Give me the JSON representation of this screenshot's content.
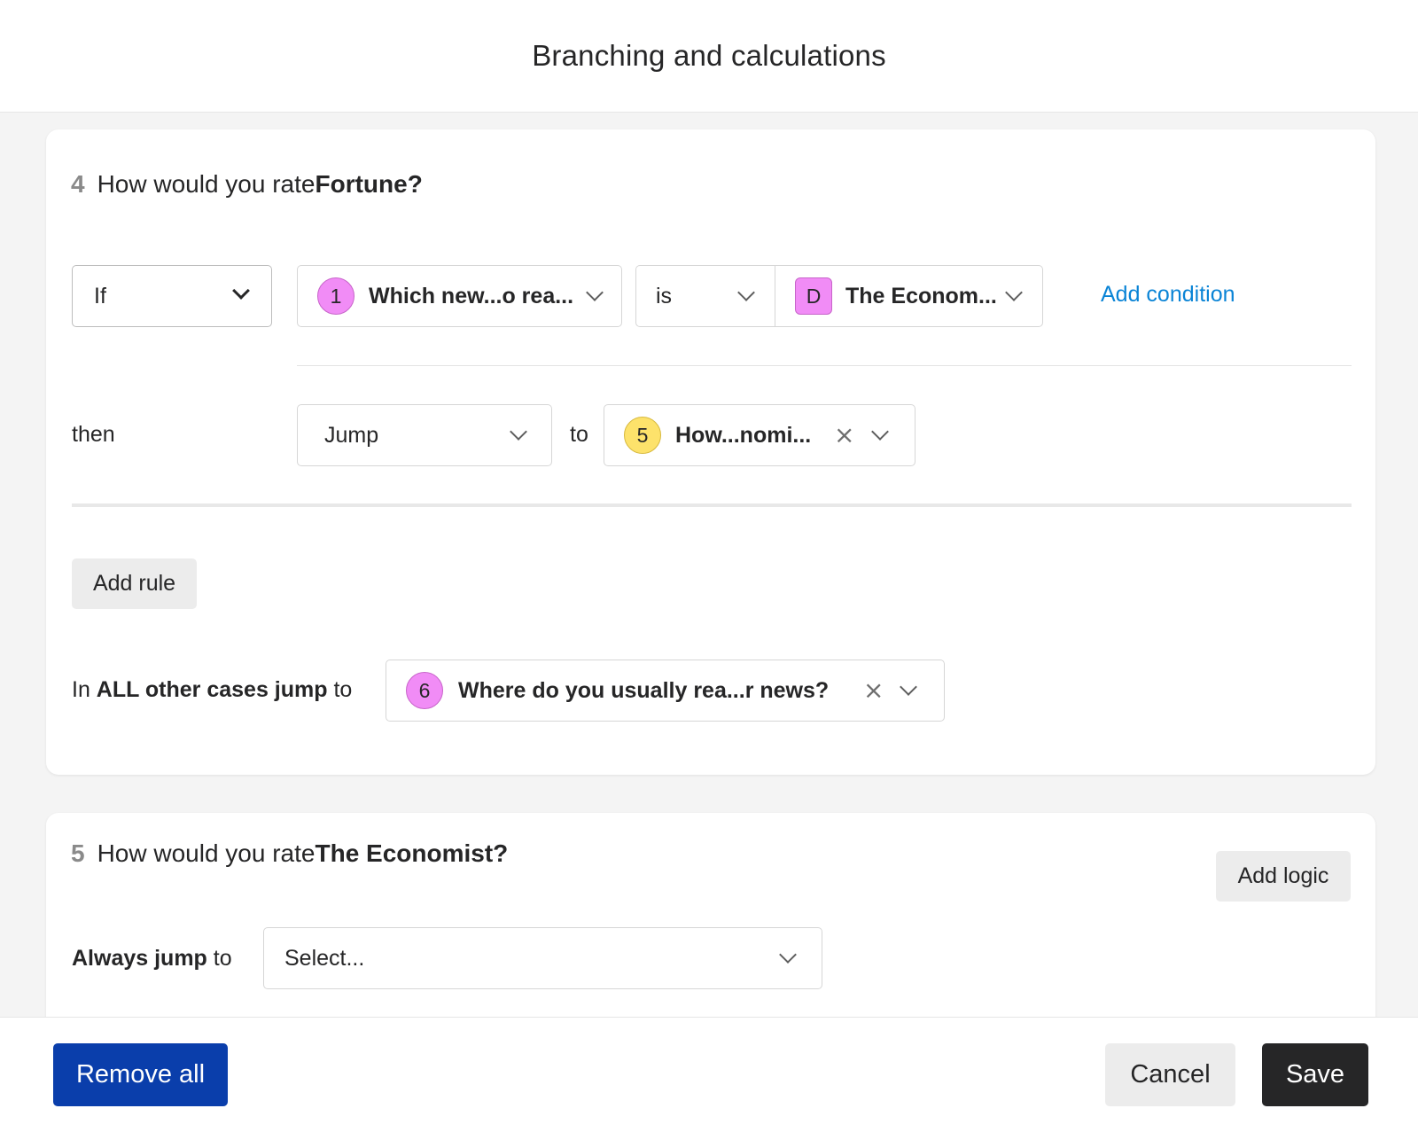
{
  "dialog": {
    "title": "Branching and calculations"
  },
  "question4": {
    "number": "4",
    "title_prefix": "How would you rate ",
    "title_bold": "Fortune?",
    "rule": {
      "operator_select": "If",
      "field_badge": "1",
      "field_label": "Which new...o rea...",
      "comparator": "is",
      "value_badge": "D",
      "value_label": "The Econom...",
      "add_condition": "Add condition",
      "then_label": "then",
      "action_select": "Jump",
      "to_label": "to",
      "target_badge": "5",
      "target_label": "How...nomi..."
    },
    "add_rule": "Add rule",
    "otherwise": {
      "prefix": "In ",
      "bold": "ALL other cases jump",
      "suffix": " to",
      "badge": "6",
      "label": "Where do you usually rea...r news?"
    }
  },
  "question5": {
    "number": "5",
    "title_prefix": "How would you rate ",
    "title_bold": "The Economist?",
    "add_logic": "Add logic",
    "always_bold": "Always jump",
    "always_suffix": " to",
    "select_placeholder": "Select..."
  },
  "footer": {
    "remove_all": "Remove all",
    "cancel": "Cancel",
    "save": "Save"
  },
  "colors": {
    "primary": "#0a3eab",
    "save": "#262627",
    "link": "#0a84d6",
    "badge_pink": "#f18cf6",
    "badge_yellow": "#fde26b"
  },
  "icons": {
    "chevron": "chevron-down-icon",
    "clear": "close-icon"
  }
}
